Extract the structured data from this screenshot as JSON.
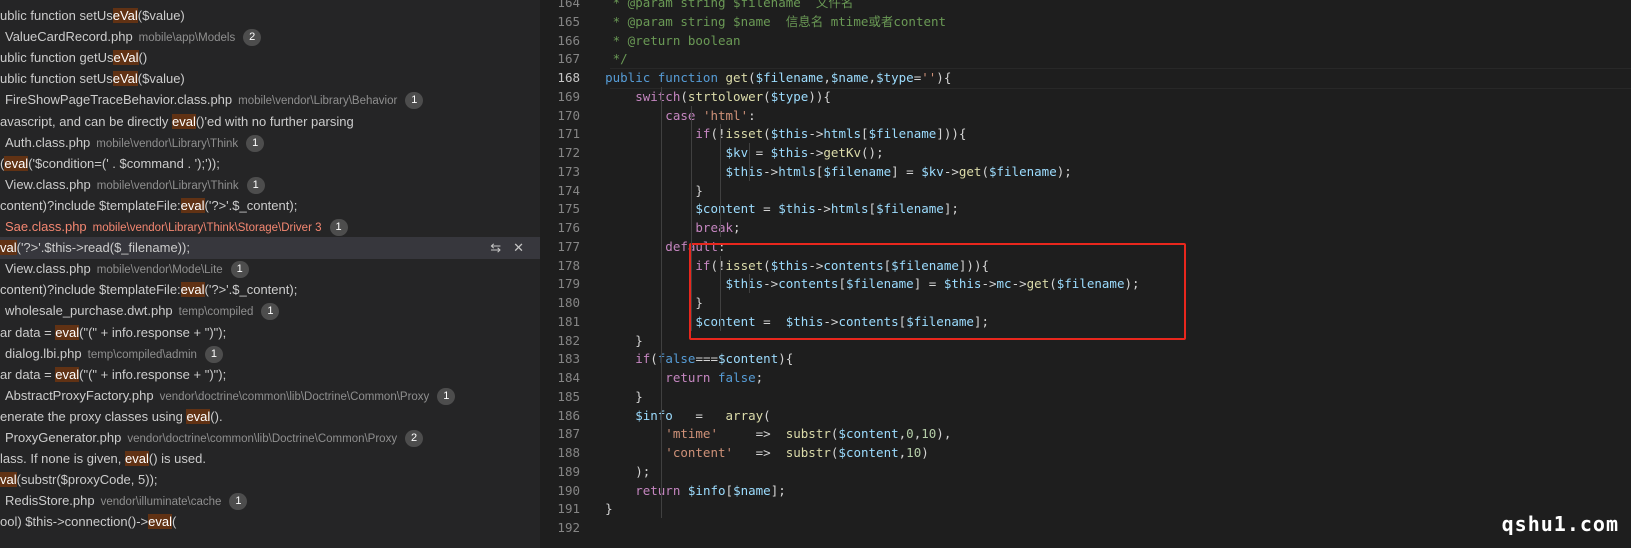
{
  "sidebar": {
    "rows": [
      {
        "type": "match",
        "pre": "ublic function setUs",
        "hl": "eVal",
        "post": "($value)"
      },
      {
        "type": "file",
        "name": "ValueCardRecord.php",
        "path": "mobile\\app\\Models",
        "count": "2"
      },
      {
        "type": "match",
        "pre": "ublic function getUs",
        "hl": "eVal",
        "post": "()"
      },
      {
        "type": "match",
        "pre": "ublic function setUs",
        "hl": "eVal",
        "post": "($value)"
      },
      {
        "type": "file",
        "name": "FireShowPageTraceBehavior.class.php",
        "path": "mobile\\vendor\\Library\\Behavior",
        "count": "1"
      },
      {
        "type": "match",
        "pre": "avascript, and can be directly ",
        "hl": "eval",
        "post": "()'ed with no further parsing"
      },
      {
        "type": "file",
        "name": "Auth.class.php",
        "path": "mobile\\vendor\\Library\\Think",
        "count": "1"
      },
      {
        "type": "match",
        "pre": "(",
        "hl": "eval",
        "post": "('$condition=(' . $command . ');'));"
      },
      {
        "type": "file",
        "name": "View.class.php",
        "path": "mobile\\vendor\\Library\\Think",
        "count": "1"
      },
      {
        "type": "match",
        "pre": "content)?include $templateFile:",
        "hl": "eval",
        "post": "('?>'.$_content);"
      },
      {
        "type": "file",
        "error": true,
        "name": "Sae.class.php",
        "path": "mobile\\vendor\\Library\\Think\\Storage\\Driver 3",
        "count": "1"
      },
      {
        "type": "match",
        "selected": true,
        "pre": "",
        "hl": "val",
        "post": "('?>'.$this->read($_filename));"
      },
      {
        "type": "file",
        "name": "View.class.php",
        "path": "mobile\\vendor\\Mode\\Lite",
        "count": "1"
      },
      {
        "type": "match",
        "pre": "content)?include $templateFile:",
        "hl": "eval",
        "post": "('?>'.$_content);"
      },
      {
        "type": "file",
        "name": "wholesale_purchase.dwt.php",
        "path": "temp\\compiled",
        "count": "1"
      },
      {
        "type": "match",
        "pre": "ar data = ",
        "hl": "eval",
        "post": "(\"(\" + info.response + \")\");"
      },
      {
        "type": "file",
        "name": "dialog.lbi.php",
        "path": "temp\\compiled\\admin",
        "count": "1"
      },
      {
        "type": "match",
        "pre": "ar data = ",
        "hl": "eval",
        "post": "(\"(\" + info.response + \")\");"
      },
      {
        "type": "file",
        "name": "AbstractProxyFactory.php",
        "path": "vendor\\doctrine\\common\\lib\\Doctrine\\Common\\Proxy",
        "count": "1"
      },
      {
        "type": "match",
        "pre": "enerate the proxy classes using ",
        "hl": "eval",
        "post": "()."
      },
      {
        "type": "file",
        "name": "ProxyGenerator.php",
        "path": "vendor\\doctrine\\common\\lib\\Doctrine\\Common\\Proxy",
        "count": "2"
      },
      {
        "type": "match",
        "pre": "lass. If none is given, ",
        "hl": "eval",
        "post": "() is used."
      },
      {
        "type": "match",
        "pre": "",
        "hl": "val",
        "post": "(substr($proxyCode, 5));"
      },
      {
        "type": "file",
        "name": "RedisStore.php",
        "path": "vendor\\illuminate\\cache",
        "count": "1"
      },
      {
        "type": "match",
        "pre": "ool) $this->connection()->",
        "hl": "eval",
        "post": "("
      }
    ],
    "actions": {
      "replace": "⇆",
      "dismiss": "✕"
    }
  },
  "editor": {
    "lines": [
      {
        "n": "164",
        "t": [
          [
            "c",
            "     * @param string $filename  文件名"
          ]
        ]
      },
      {
        "n": "165",
        "t": [
          [
            "c",
            "     * @param string $name  信息名 mtime或者content"
          ]
        ]
      },
      {
        "n": "166",
        "t": [
          [
            "c",
            "     * @return boolean"
          ]
        ]
      },
      {
        "n": "167",
        "t": [
          [
            "c",
            "     */"
          ]
        ]
      },
      {
        "n": "168",
        "active": true,
        "t": [
          [
            "kb",
            "    public function "
          ],
          [
            "f",
            "get"
          ],
          [
            "p",
            "("
          ],
          [
            "v",
            "$filename"
          ],
          [
            "p",
            ","
          ],
          [
            "v",
            "$name"
          ],
          [
            "p",
            ","
          ],
          [
            "v",
            "$type"
          ],
          [
            "p",
            "="
          ],
          [
            "s",
            "''"
          ],
          [
            "p",
            "){"
          ]
        ]
      },
      {
        "n": "169",
        "t": [
          [
            "k",
            "        switch"
          ],
          [
            "p",
            "("
          ],
          [
            "f",
            "strtolower"
          ],
          [
            "p",
            "("
          ],
          [
            "v",
            "$type"
          ],
          [
            "p",
            "))"
          ],
          [
            "p",
            "{"
          ]
        ]
      },
      {
        "n": "170",
        "t": [
          [
            "k",
            "            case "
          ],
          [
            "s",
            "'html'"
          ],
          [
            "p",
            ":"
          ]
        ]
      },
      {
        "n": "171",
        "t": [
          [
            "k",
            "                if"
          ],
          [
            "p",
            "(!"
          ],
          [
            "f",
            "isset"
          ],
          [
            "p",
            "("
          ],
          [
            "v",
            "$this"
          ],
          [
            "p",
            "->"
          ],
          [
            "v",
            "htmls"
          ],
          [
            "p",
            "["
          ],
          [
            "v",
            "$filename"
          ],
          [
            "p",
            "])){"
          ]
        ]
      },
      {
        "n": "172",
        "t": [
          [
            "v",
            "                    $kv"
          ],
          [
            "p",
            " = "
          ],
          [
            "v",
            "$this"
          ],
          [
            "p",
            "->"
          ],
          [
            "f",
            "getKv"
          ],
          [
            "p",
            "();"
          ]
        ]
      },
      {
        "n": "173",
        "t": [
          [
            "v",
            "                    $this"
          ],
          [
            "p",
            "->"
          ],
          [
            "v",
            "htmls"
          ],
          [
            "p",
            "["
          ],
          [
            "v",
            "$filename"
          ],
          [
            "p",
            "] = "
          ],
          [
            "v",
            "$kv"
          ],
          [
            "p",
            "->"
          ],
          [
            "f",
            "get"
          ],
          [
            "p",
            "("
          ],
          [
            "v",
            "$filename"
          ],
          [
            "p",
            ");"
          ]
        ]
      },
      {
        "n": "174",
        "t": [
          [
            "p",
            "                }"
          ]
        ]
      },
      {
        "n": "175",
        "t": [
          [
            "v",
            "                $content"
          ],
          [
            "p",
            " = "
          ],
          [
            "v",
            "$this"
          ],
          [
            "p",
            "->"
          ],
          [
            "v",
            "htmls"
          ],
          [
            "p",
            "["
          ],
          [
            "v",
            "$filename"
          ],
          [
            "p",
            "];"
          ]
        ]
      },
      {
        "n": "176",
        "t": [
          [
            "k",
            "                break"
          ],
          [
            "p",
            ";"
          ]
        ]
      },
      {
        "n": "177",
        "t": [
          [
            "k",
            "            default"
          ],
          [
            "p",
            ":"
          ]
        ]
      },
      {
        "n": "178",
        "t": [
          [
            "k",
            "                if"
          ],
          [
            "p",
            "(!"
          ],
          [
            "f",
            "isset"
          ],
          [
            "p",
            "("
          ],
          [
            "v",
            "$this"
          ],
          [
            "p",
            "->"
          ],
          [
            "v",
            "contents"
          ],
          [
            "p",
            "["
          ],
          [
            "v",
            "$filename"
          ],
          [
            "p",
            "])){"
          ]
        ]
      },
      {
        "n": "179",
        "t": [
          [
            "v",
            "                    $this"
          ],
          [
            "p",
            "->"
          ],
          [
            "v",
            "contents"
          ],
          [
            "p",
            "["
          ],
          [
            "v",
            "$filename"
          ],
          [
            "p",
            "] = "
          ],
          [
            "v",
            "$this"
          ],
          [
            "p",
            "->"
          ],
          [
            "v",
            "mc"
          ],
          [
            "p",
            "->"
          ],
          [
            "f",
            "get"
          ],
          [
            "p",
            "("
          ],
          [
            "v",
            "$filename"
          ],
          [
            "p",
            ");"
          ]
        ]
      },
      {
        "n": "180",
        "t": [
          [
            "p",
            "                }"
          ]
        ]
      },
      {
        "n": "181",
        "t": [
          [
            "v",
            "                $content"
          ],
          [
            "p",
            " =  "
          ],
          [
            "v",
            "$this"
          ],
          [
            "p",
            "->"
          ],
          [
            "v",
            "contents"
          ],
          [
            "p",
            "["
          ],
          [
            "v",
            "$filename"
          ],
          [
            "p",
            "];"
          ]
        ]
      },
      {
        "n": "182",
        "t": [
          [
            "p",
            "        }"
          ]
        ]
      },
      {
        "n": "183",
        "t": [
          [
            "k",
            "        if"
          ],
          [
            "p",
            "("
          ],
          [
            "kb",
            "false"
          ],
          [
            "p",
            "==="
          ],
          [
            "v",
            "$content"
          ],
          [
            "p",
            "){"
          ]
        ]
      },
      {
        "n": "184",
        "t": [
          [
            "k",
            "            return "
          ],
          [
            "kb",
            "false"
          ],
          [
            "p",
            ";"
          ]
        ]
      },
      {
        "n": "185",
        "t": [
          [
            "p",
            "        }"
          ]
        ]
      },
      {
        "n": "186",
        "t": [
          [
            "v",
            "        $info"
          ],
          [
            "p",
            "   =   "
          ],
          [
            "f",
            "array"
          ],
          [
            "p",
            "("
          ]
        ]
      },
      {
        "n": "187",
        "t": [
          [
            "s",
            "            'mtime'"
          ],
          [
            "p",
            "     =>  "
          ],
          [
            "f",
            "substr"
          ],
          [
            "p",
            "("
          ],
          [
            "v",
            "$content"
          ],
          [
            "p",
            ","
          ],
          [
            "n",
            "0"
          ],
          [
            "p",
            ","
          ],
          [
            "n",
            "10"
          ],
          [
            "p",
            "),"
          ]
        ]
      },
      {
        "n": "188",
        "t": [
          [
            "s",
            "            'content'"
          ],
          [
            "p",
            "   =>  "
          ],
          [
            "f",
            "substr"
          ],
          [
            "p",
            "("
          ],
          [
            "v",
            "$content"
          ],
          [
            "p",
            ","
          ],
          [
            "n",
            "10"
          ],
          [
            "p",
            ")"
          ]
        ]
      },
      {
        "n": "189",
        "t": [
          [
            "p",
            "        );"
          ]
        ]
      },
      {
        "n": "190",
        "t": [
          [
            "k",
            "        return "
          ],
          [
            "v",
            "$info"
          ],
          [
            "p",
            "["
          ],
          [
            "v",
            "$name"
          ],
          [
            "p",
            "];"
          ]
        ]
      },
      {
        "n": "191",
        "t": [
          [
            "p",
            "    }"
          ]
        ]
      },
      {
        "n": "192",
        "t": []
      }
    ]
  },
  "watermark": "qshu1.com",
  "colors": {
    "highlight_box": "#e8271d",
    "match_highlight": "#613214",
    "error_file": "#f48771"
  }
}
